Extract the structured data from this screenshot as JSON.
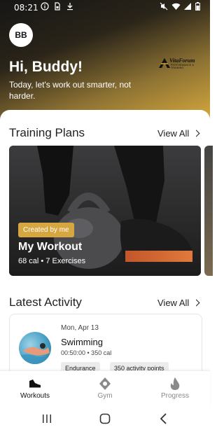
{
  "status_bar": {
    "time": "08:21",
    "left_icons": [
      "info-icon",
      "sim-icon",
      "download-icon"
    ],
    "right_icons": [
      "mute-icon",
      "wifi-icon",
      "signal-icon",
      "battery-icon"
    ]
  },
  "header": {
    "avatar_initials": "BB",
    "greeting": "Hi, Buddy!",
    "subtitle": "Today, let's work out smarter, not harder.",
    "logo_name": "VitaForum",
    "logo_sub": "PERFORMANCE & TRAINING"
  },
  "training_plans": {
    "title": "Training Plans",
    "view_all": "View All",
    "card": {
      "badge": "Created by me",
      "title": "My Workout",
      "meta": "68 cal • 7 Exercises"
    }
  },
  "latest_activity": {
    "title": "Latest Activity",
    "view_all": "View All",
    "item": {
      "date": "Mon, Apr 13",
      "name": "Swimming",
      "meta": "00:50:00 • 350 cal",
      "tags": [
        "Endurance",
        "350 activity points"
      ]
    }
  },
  "bottom_nav": {
    "items": [
      {
        "label": "Workouts",
        "icon": "shoe-icon",
        "active": true
      },
      {
        "label": "Gym",
        "icon": "location-pin-icon",
        "active": false
      },
      {
        "label": "Progress",
        "icon": "flame-icon",
        "active": false
      }
    ]
  },
  "colors": {
    "accent": "#d6a640",
    "header_dark": "#161616",
    "active_nav": "#111111",
    "inactive_nav": "#8a8a8a"
  }
}
